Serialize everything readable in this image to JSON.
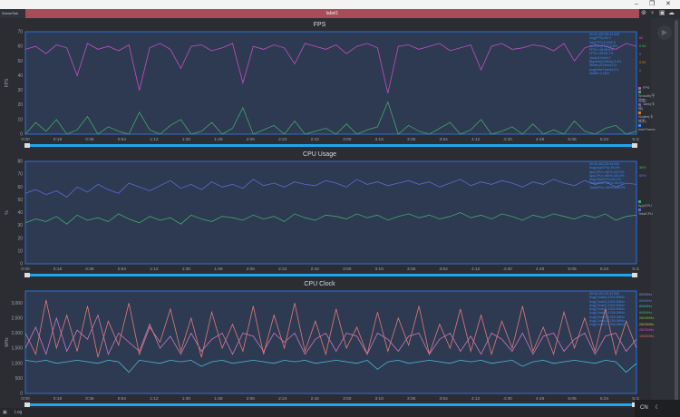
{
  "window": {
    "minimize": "–",
    "maximize": "❐",
    "close": "✕"
  },
  "header": {
    "tab": "SceneTab",
    "label": "label1",
    "icons": [
      "location-icon",
      "pin-icon",
      "folder-icon",
      "cloud-icon"
    ]
  },
  "x_ticks": [
    "0:00",
    "0:18",
    "0:36",
    "0:54",
    "1:12",
    "1:30",
    "1:48",
    "2:06",
    "2:24",
    "2:42",
    "3:00",
    "3:18",
    "3:36",
    "3:54",
    "4:12",
    "4:30",
    "4:48",
    "5:06",
    "5:24",
    "5:43"
  ],
  "charts": [
    {
      "type": "line",
      "title": "FPS",
      "ylabel": "FPS",
      "ylim": [
        0,
        70
      ],
      "yticks": [
        "0",
        "10",
        "20",
        "30",
        "40",
        "50",
        "60",
        "70"
      ],
      "stats": [
        "00:00.452-05:43.000",
        "Avg(FPS):54.9",
        "Var(FPS):6.9/63.9",
        "Smooth(FPS):5.8%",
        "FPS>=18:98.0%",
        "FPS>=25:96.7%",
        "Jank(/10min):7",
        "BigJank(/10min):3.4%",
        "Stutter(/10min):0.0",
        "Avg(InterFrame):0.0",
        "Stutter:0.18%"
      ],
      "right_values": [
        {
          "text": "60",
          "color": "#d04ad0"
        },
        {
          "text": "0.93",
          "color": "#3fbf6f"
        },
        {
          "text": "0",
          "color": "#6a6af0"
        },
        {
          "text": "0.00",
          "color": "#e07b2f"
        },
        {
          "text": "0",
          "color": "#3d8cf0"
        }
      ],
      "legend": [
        {
          "name": "FPS",
          "color": "#c24fc2"
        },
        {
          "name": "Smooth(平滑度)",
          "color": "#3fa86a"
        },
        {
          "name": "Jank(卡顿)",
          "color": "#6a5ae0"
        },
        {
          "name": "Stutter(卡顿率)",
          "color": "#e07b2f"
        },
        {
          "name": "InterFrame",
          "color": "#3d8cf0"
        }
      ],
      "series": [
        {
          "name": "FPS",
          "color": "#c24fc2",
          "values": [
            58,
            60,
            55,
            61,
            59,
            40,
            62,
            58,
            60,
            57,
            61,
            30,
            59,
            62,
            58,
            45,
            60,
            61,
            57,
            59,
            62,
            35,
            60,
            58,
            61,
            59,
            48,
            62,
            60,
            58,
            61,
            55,
            60,
            62,
            59,
            28,
            60,
            61,
            58,
            60,
            62,
            57,
            59,
            61,
            44,
            60,
            62,
            58,
            59,
            61,
            60,
            57,
            62,
            50,
            59,
            61,
            60,
            58,
            62,
            60
          ]
        },
        {
          "name": "Smooth(平滑度)",
          "color": "#3fa86a",
          "values": [
            0,
            8,
            2,
            10,
            0,
            3,
            12,
            0,
            5,
            2,
            0,
            15,
            3,
            0,
            6,
            10,
            0,
            2,
            8,
            0,
            4,
            18,
            0,
            3,
            6,
            0,
            9,
            0,
            2,
            4,
            0,
            7,
            0,
            3,
            5,
            22,
            0,
            6,
            2,
            0,
            4,
            8,
            0,
            3,
            10,
            0,
            2,
            5,
            0,
            7,
            0,
            3,
            0,
            9,
            2,
            0,
            4,
            6,
            0,
            2
          ]
        }
      ]
    },
    {
      "type": "line",
      "title": "CPU Usage",
      "ylabel": "%",
      "ylim": [
        0,
        80
      ],
      "yticks": [
        "0",
        "10",
        "20",
        "30",
        "40",
        "50",
        "60",
        "70",
        "80"
      ],
      "stats": [
        "00:00.452-05:43.000",
        "Avg(AppCPU):36.9%",
        "AppCPU<=60%:100.0%",
        "AppCPU<=80%:100.0%",
        "Avg(TotalCPU):63.1%",
        "TotalCPU<=60%:36.0%",
        "TotalCPU<=80%:100.0%"
      ],
      "right_values": [
        {
          "text": "36%",
          "color": "#3fbf6f"
        },
        {
          "text": "60%",
          "color": "#6a7af0"
        }
      ],
      "legend": [
        {
          "name": "AppCPU",
          "color": "#3fa86a"
        },
        {
          "name": "TotalCPU",
          "color": "#5a6ad8"
        }
      ],
      "series": [
        {
          "name": "TotalCPU",
          "color": "#5a6ad8",
          "values": [
            55,
            58,
            54,
            57,
            52,
            60,
            56,
            62,
            58,
            55,
            63,
            60,
            57,
            61,
            65,
            59,
            62,
            58,
            64,
            60,
            62,
            59,
            66,
            61,
            63,
            60,
            64,
            62,
            61,
            65,
            63,
            60,
            66,
            62,
            64,
            61,
            63,
            65,
            62,
            64,
            60,
            63,
            66,
            61,
            64,
            62,
            65,
            63,
            60,
            64,
            62,
            66,
            63,
            61,
            65,
            62,
            64,
            60,
            63,
            62
          ]
        },
        {
          "name": "AppCPU",
          "color": "#3fa86a",
          "values": [
            32,
            35,
            33,
            37,
            31,
            38,
            34,
            36,
            33,
            39,
            35,
            32,
            37,
            34,
            36,
            31,
            38,
            35,
            33,
            37,
            36,
            34,
            38,
            35,
            37,
            33,
            39,
            36,
            34,
            38,
            37,
            35,
            39,
            36,
            38,
            34,
            37,
            39,
            36,
            38,
            35,
            37,
            40,
            36,
            38,
            35,
            39,
            37,
            34,
            38,
            36,
            39,
            37,
            35,
            38,
            36,
            39,
            34,
            37,
            38
          ]
        }
      ]
    },
    {
      "type": "line",
      "title": "CPU Clock",
      "ylabel": "MHz",
      "ylim": [
        0,
        3400
      ],
      "yticks": [
        "0",
        "500",
        "1,000",
        "1,500",
        "2,000",
        "2,500",
        "3,000"
      ],
      "stats": [
        "00:00.452-05:43.000",
        "Avg(Clock0):1004.5MHz",
        "Avg(Clock1):1004.5MHz",
        "Avg(Clock2):1004.5MHz",
        "Avg(Clock3):1004.5MHz",
        "Avg(Clock4):1765.0MHz",
        "Avg(Clock5):1765.0MHz",
        "Avg(Clock6):1765.0MHz",
        "Avg(Clock7):1765.0MHz"
      ],
      "right_values": [
        {
          "text": "600MHz",
          "color": "#8a8ae0"
        },
        {
          "text": "600MHz",
          "color": "#3d8cf0"
        },
        {
          "text": "600MHz",
          "color": "#3fbfbf"
        },
        {
          "text": "600MHz",
          "color": "#3fbf6f"
        },
        {
          "text": "2803MHz",
          "color": "#7fbf3f"
        },
        {
          "text": "2803MHz",
          "color": "#bfbf3f"
        },
        {
          "text": "2803MHz",
          "color": "#d04ad0"
        },
        {
          "text": "1363MHz",
          "color": "#e06a6a"
        }
      ],
      "legend": [],
      "series": [
        {
          "name": "Clock0",
          "color": "#4ab8d8",
          "values": [
            1100,
            1050,
            1100,
            1000,
            1050,
            1100,
            1050,
            1000,
            1100,
            1050,
            700,
            1100,
            1050,
            1000,
            1100,
            1050,
            1100,
            900,
            1050,
            1100,
            1000,
            1050,
            1100,
            1050,
            1000,
            1100,
            1050,
            1100,
            1000,
            1050,
            1100,
            1050,
            1000,
            1100,
            800,
            1050,
            1100,
            1000,
            1050,
            1100,
            1050,
            1000,
            1100,
            1050,
            1100,
            1000,
            1050,
            1100,
            900,
            1050,
            1100,
            1000,
            1050,
            1100,
            1050,
            1000,
            1100,
            1050,
            700,
            1000
          ]
        },
        {
          "name": "Clock4",
          "color": "#c77ab8",
          "values": [
            1500,
            2200,
            1300,
            2500,
            1400,
            2100,
            1800,
            2600,
            1300,
            2000,
            1700,
            1400,
            2300,
            1500,
            1900,
            1300,
            2000,
            1400,
            1800,
            2000,
            1300,
            2000,
            1900,
            1400,
            2000,
            1700,
            2000,
            1300,
            1800,
            2000,
            1400,
            2000,
            1900,
            1300,
            2000,
            1800,
            1400,
            1900,
            2000,
            1300,
            1800,
            2000,
            1400,
            1900,
            1300,
            2000,
            1800,
            1400,
            2000,
            1300,
            1900,
            2000,
            1400,
            1800,
            2000,
            1300,
            1900,
            2000,
            1400,
            1800
          ]
        },
        {
          "name": "Clock7",
          "color": "#e07a7a",
          "values": [
            2000,
            1300,
            3100,
            1500,
            2600,
            1400,
            2900,
            1200,
            2400,
            1600,
            3000,
            1300,
            2200,
            1700,
            2800,
            1400,
            2500,
            1200,
            2700,
            1500,
            2300,
            1400,
            2900,
            1300,
            2600,
            1500,
            3000,
            1400,
            2400,
            1300,
            2800,
            1500,
            2200,
            1300,
            2700,
            1400,
            2500,
            1600,
            2900,
            1300,
            2300,
            1500,
            2800,
            1400,
            2600,
            1300,
            2400,
            1500,
            2900,
            1400,
            2200,
            1300,
            2700,
            1500,
            2500,
            1400,
            2800,
            1300,
            2400,
            1500
          ]
        }
      ]
    }
  ],
  "bottom": {
    "log": "Log",
    "lang": "CN",
    "theme": "☾"
  }
}
